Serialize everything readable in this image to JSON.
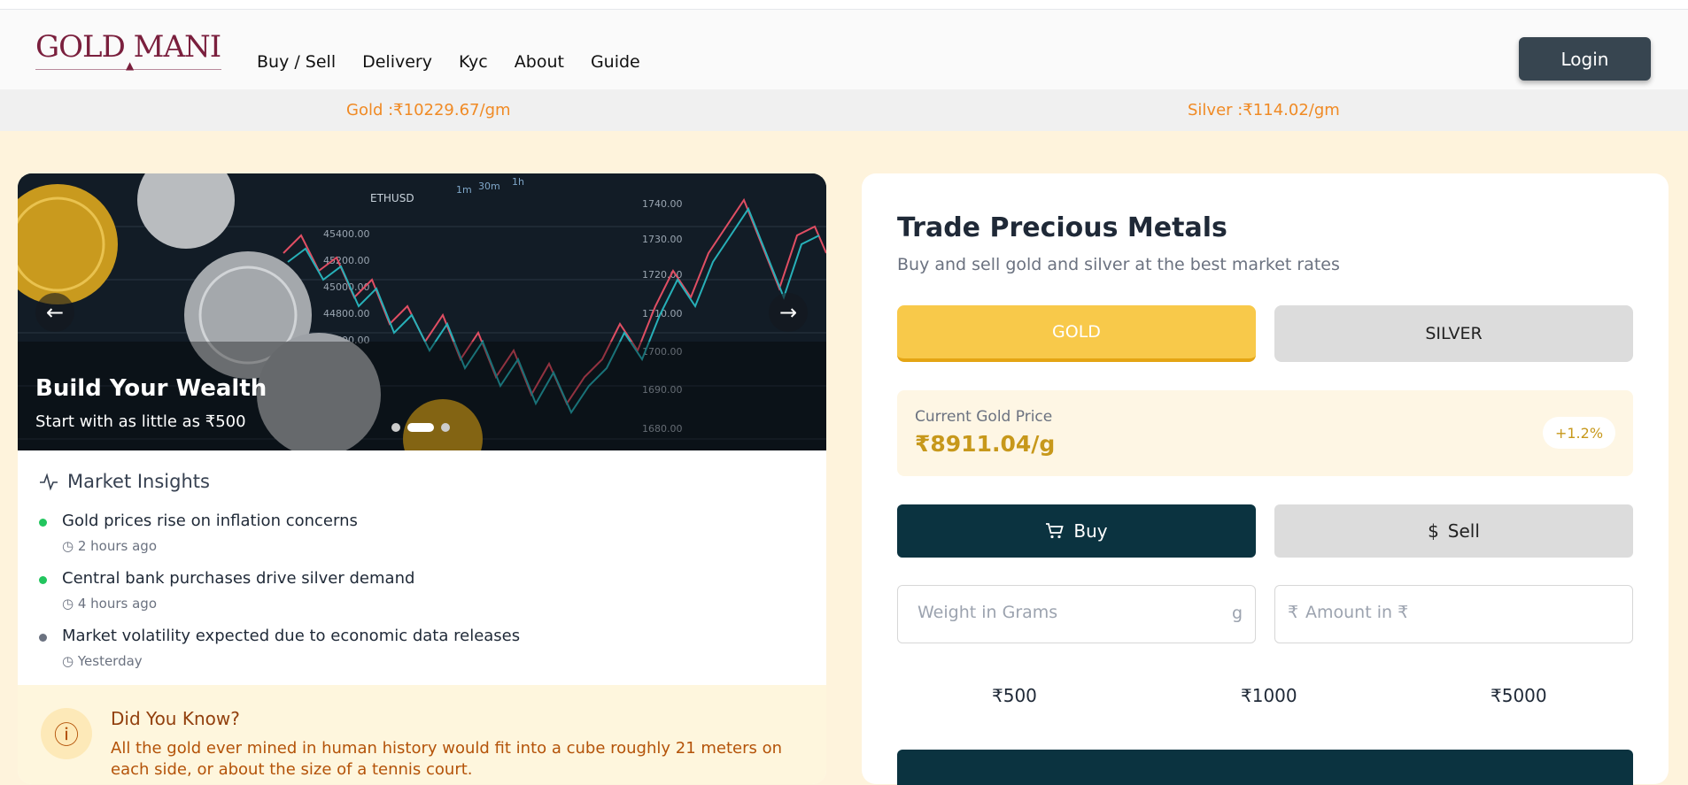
{
  "brand": {
    "logo_text": "GOLD MANI"
  },
  "nav": {
    "items": [
      "Buy / Sell",
      "Delivery",
      "Kyc",
      "About",
      "Guide"
    ],
    "login_label": "Login"
  },
  "ticker": {
    "gold": "Gold :₹10229.67/gm",
    "silver": "Silver :₹114.02/gm"
  },
  "hero": {
    "title": "Build Your Wealth",
    "subtitle": "Start with as little as ₹500",
    "prev_icon": "arrow-left-icon",
    "next_icon": "arrow-right-icon",
    "slide_count": 3,
    "active_slide": 2,
    "chart_labels": {
      "symbol": "ETHUSD",
      "tf1": "1m",
      "tf2": "30m",
      "tf3": "1h",
      "prices": [
        "45400.00",
        "45200.00",
        "45000.00",
        "44800.00",
        "44600.00",
        "1740.00",
        "1730.00",
        "1720.00",
        "1710.00",
        "1700.00",
        "1690.00",
        "1680.00"
      ]
    }
  },
  "insights": {
    "title": "Market Insights",
    "icon": "activity-icon",
    "items": [
      {
        "text": "Gold prices rise on inflation concerns",
        "time": "2 hours ago",
        "color": "#22c55e"
      },
      {
        "text": "Central bank purchases drive silver demand",
        "time": "4 hours ago",
        "color": "#22c55e"
      },
      {
        "text": "Market volatility expected due to economic data releases",
        "time": "Yesterday",
        "color": "#6b7280"
      }
    ]
  },
  "did_you_know": {
    "title": "Did You Know?",
    "text": "All the gold ever mined in human history would fit into a cube roughly 21 meters on each side, or about the size of a tennis court."
  },
  "trade": {
    "title": "Trade Precious Metals",
    "subtitle": "Buy and sell gold and silver at the best market rates",
    "metal_tabs": [
      "GOLD",
      "SILVER"
    ],
    "price_label": "Current Gold Price",
    "price_value": "₹8911.04/g",
    "price_change": "+1.2%",
    "buy_label": "Buy",
    "sell_label": "Sell",
    "weight_placeholder": "Weight in Grams",
    "weight_unit": "g",
    "amount_prefix": "₹",
    "amount_placeholder": "Amount in ₹",
    "quick_amounts": [
      "₹500",
      "₹1000",
      "₹5000"
    ]
  },
  "colors": {
    "accent_gold": "#f8c94a",
    "dark_teal": "#0b3340",
    "ticker_orange": "#f08a24",
    "page_bg": "#fef3dc"
  }
}
